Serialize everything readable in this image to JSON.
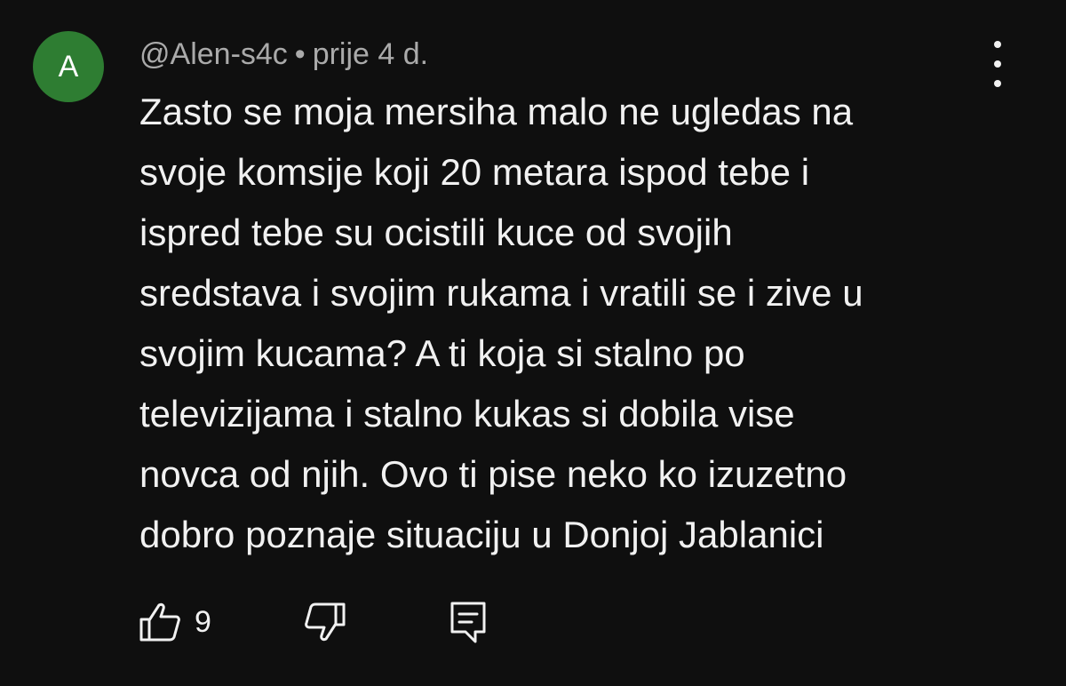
{
  "comment": {
    "avatar_letter": "A",
    "avatar_color": "#2e7d32",
    "author": "@Alen-s4c",
    "separator": "•",
    "time": "prije 4 d.",
    "lines": [
      "Zasto se moja mersiha malo ne ugledas na",
      "svoje komsije koji 20 metara ispod tebe i",
      "ispred tebe su ocistili kuce od svojih",
      "sredstava i svojim rukama i vratili se i zive u",
      "svojim kucama? A ti koja si stalno po",
      "televizijama i stalno kukas si dobila vise",
      "novca od njih. Ovo ti pise neko ko izuzetno",
      "dobro poznaje situaciju u Donjoj Jablanici"
    ],
    "like_count": "9"
  },
  "icons": {
    "like": "thumb-up-icon",
    "dislike": "thumb-down-icon",
    "reply": "comment-reply-icon",
    "menu": "more-vertical-icon"
  }
}
